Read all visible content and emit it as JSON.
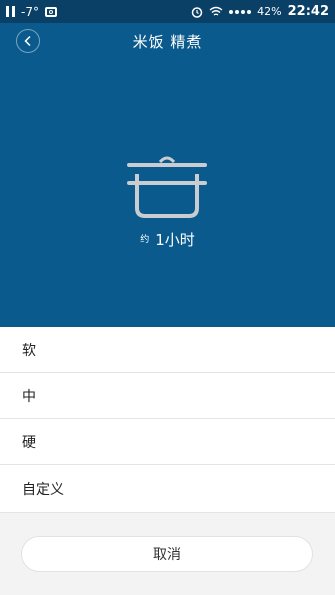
{
  "status_bar": {
    "temperature": "-7°",
    "battery": "42%",
    "time": "22:42"
  },
  "header": {
    "title": "米饭 精煮"
  },
  "duration": {
    "prefix": "约",
    "value": "1小时"
  },
  "options": [
    {
      "label": "软"
    },
    {
      "label": "中"
    },
    {
      "label": "硬"
    },
    {
      "label": "自定义"
    }
  ],
  "cancel_label": "取消",
  "colors": {
    "panel": "#0a5a8e",
    "status_bar": "#0a3f66",
    "icon_stroke": "#c9cdd1"
  }
}
